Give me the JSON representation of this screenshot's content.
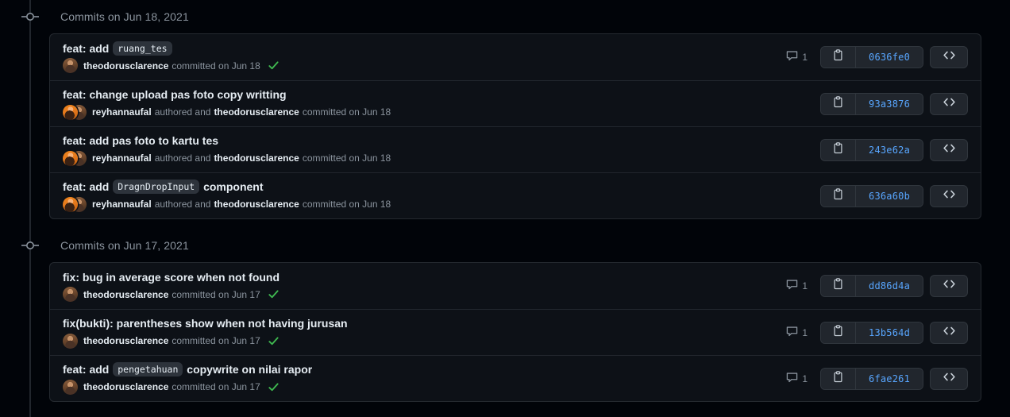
{
  "page": {
    "colors": {
      "page_background": "#010409",
      "card_background": "#0d1117",
      "card_border": "#24292f",
      "row_divider": "#21262d",
      "button_background": "#21262d",
      "button_border": "#30363d",
      "link_blue": "#58a6ff",
      "text_primary": "#e6edf3",
      "text_muted": "#8b949e",
      "verified_green": "#3fb950"
    }
  },
  "groups": [
    {
      "header": "Commits on Jun 18, 2021",
      "marker_icon": "timeline-commit-node-icon",
      "commits": [
        {
          "title_prefix": "feat: add",
          "title_code": "ruang_tes",
          "title_suffix": "",
          "authored_by": "",
          "authored_label": "",
          "committer": "theodorusclarence",
          "committed_label": "committed on Jun 18",
          "verified": true,
          "avatar_mode": "single",
          "comment_count": "1",
          "sha": "0636fe0",
          "copy_icon": "clipboard-icon",
          "code_icon": "code-brackets-icon"
        },
        {
          "title_prefix": "feat: change upload pas foto copy writting",
          "title_code": "",
          "title_suffix": "",
          "authored_by": "reyhannaufal",
          "authored_label": "authored and",
          "committer": "theodorusclarence",
          "committed_label": "committed on Jun 18",
          "verified": false,
          "avatar_mode": "dual",
          "comment_count": "",
          "sha": "93a3876",
          "copy_icon": "clipboard-icon",
          "code_icon": "code-brackets-icon"
        },
        {
          "title_prefix": "feat: add pas foto to kartu tes",
          "title_code": "",
          "title_suffix": "",
          "authored_by": "reyhannaufal",
          "authored_label": "authored and",
          "committer": "theodorusclarence",
          "committed_label": "committed on Jun 18",
          "verified": false,
          "avatar_mode": "dual",
          "comment_count": "",
          "sha": "243e62a",
          "copy_icon": "clipboard-icon",
          "code_icon": "code-brackets-icon"
        },
        {
          "title_prefix": "feat: add",
          "title_code": "DragnDropInput",
          "title_suffix": "component",
          "authored_by": "reyhannaufal",
          "authored_label": "authored and",
          "committer": "theodorusclarence",
          "committed_label": "committed on Jun 18",
          "verified": false,
          "avatar_mode": "dual",
          "comment_count": "",
          "sha": "636a60b",
          "copy_icon": "clipboard-icon",
          "code_icon": "code-brackets-icon"
        }
      ]
    },
    {
      "header": "Commits on Jun 17, 2021",
      "marker_icon": "timeline-commit-node-icon",
      "commits": [
        {
          "title_prefix": "fix: bug in average score when not found",
          "title_code": "",
          "title_suffix": "",
          "authored_by": "",
          "authored_label": "",
          "committer": "theodorusclarence",
          "committed_label": "committed on Jun 17",
          "verified": true,
          "avatar_mode": "single",
          "comment_count": "1",
          "sha": "dd86d4a",
          "copy_icon": "clipboard-icon",
          "code_icon": "code-brackets-icon"
        },
        {
          "title_prefix": "fix(bukti): parentheses show when not having jurusan",
          "title_code": "",
          "title_suffix": "",
          "authored_by": "",
          "authored_label": "",
          "committer": "theodorusclarence",
          "committed_label": "committed on Jun 17",
          "verified": true,
          "avatar_mode": "single",
          "comment_count": "1",
          "sha": "13b564d",
          "copy_icon": "clipboard-icon",
          "code_icon": "code-brackets-icon"
        },
        {
          "title_prefix": "feat: add",
          "title_code": "pengetahuan",
          "title_suffix": "copywrite on nilai rapor",
          "authored_by": "",
          "authored_label": "",
          "committer": "theodorusclarence",
          "committed_label": "committed on Jun 17",
          "verified": true,
          "avatar_mode": "single",
          "comment_count": "1",
          "sha": "6fae261",
          "copy_icon": "clipboard-icon",
          "code_icon": "code-brackets-icon"
        }
      ]
    }
  ]
}
